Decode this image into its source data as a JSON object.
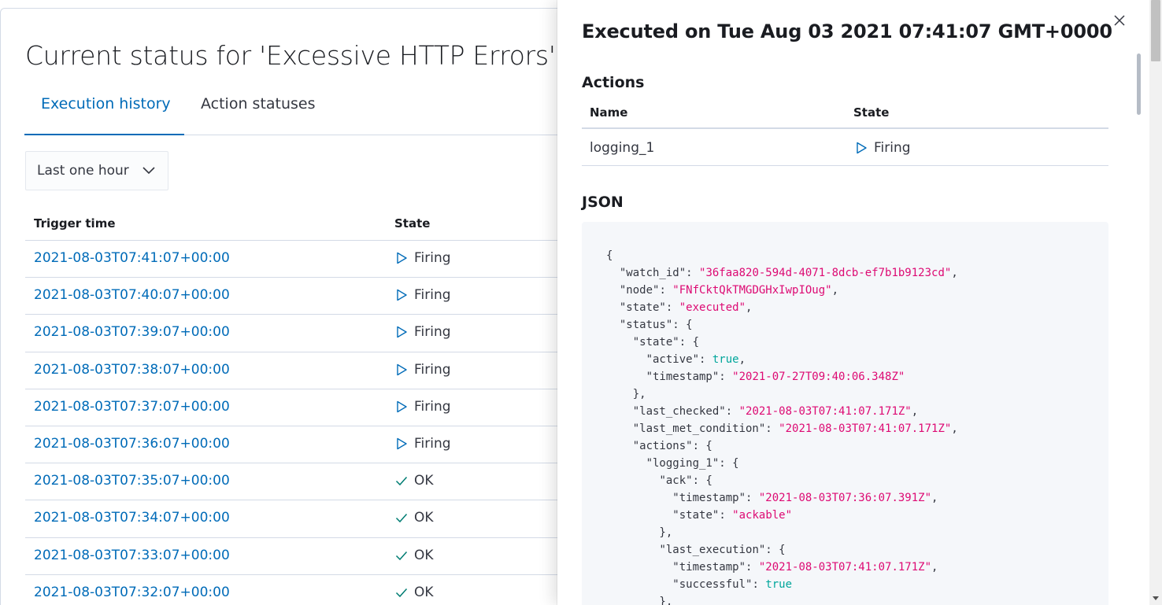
{
  "page": {
    "title": "Current status for 'Excessive HTTP Errors'",
    "tabs": [
      {
        "label": "Execution history",
        "active": true
      },
      {
        "label": "Action statuses",
        "active": false
      }
    ],
    "range_select": {
      "value": "Last one hour",
      "icon": "chevron-down-icon"
    },
    "history_table": {
      "columns": [
        "Trigger time",
        "State"
      ],
      "rows": [
        {
          "time": "2021-08-03T07:41:07+00:00",
          "state": "Firing",
          "icon": "play-icon"
        },
        {
          "time": "2021-08-03T07:40:07+00:00",
          "state": "Firing",
          "icon": "play-icon"
        },
        {
          "time": "2021-08-03T07:39:07+00:00",
          "state": "Firing",
          "icon": "play-icon"
        },
        {
          "time": "2021-08-03T07:38:07+00:00",
          "state": "Firing",
          "icon": "play-icon"
        },
        {
          "time": "2021-08-03T07:37:07+00:00",
          "state": "Firing",
          "icon": "play-icon"
        },
        {
          "time": "2021-08-03T07:36:07+00:00",
          "state": "Firing",
          "icon": "play-icon"
        },
        {
          "time": "2021-08-03T07:35:07+00:00",
          "state": "OK",
          "icon": "check-icon"
        },
        {
          "time": "2021-08-03T07:34:07+00:00",
          "state": "OK",
          "icon": "check-icon"
        },
        {
          "time": "2021-08-03T07:33:07+00:00",
          "state": "OK",
          "icon": "check-icon"
        },
        {
          "time": "2021-08-03T07:32:07+00:00",
          "state": "OK",
          "icon": "check-icon"
        }
      ]
    }
  },
  "flyout": {
    "title": "Executed on Tue Aug 03 2021 07:41:07 GMT+0000",
    "close_icon": "close-icon",
    "actions_title": "Actions",
    "actions_table": {
      "columns": [
        "Name",
        "State"
      ],
      "rows": [
        {
          "name": "logging_1",
          "state": "Firing",
          "icon": "play-icon"
        }
      ]
    },
    "json_title": "JSON",
    "json_lines": [
      [
        [
          "p",
          "{"
        ]
      ],
      [
        [
          "p",
          "  "
        ],
        [
          "k",
          "\"watch_id\""
        ],
        [
          "p",
          ": "
        ],
        [
          "s",
          "\"36faa820-594d-4071-8dcb-ef7b1b9123cd\""
        ],
        [
          "p",
          ","
        ]
      ],
      [
        [
          "p",
          "  "
        ],
        [
          "k",
          "\"node\""
        ],
        [
          "p",
          ": "
        ],
        [
          "s",
          "\"FNfCktQkTMGDGHxIwpIOug\""
        ],
        [
          "p",
          ","
        ]
      ],
      [
        [
          "p",
          "  "
        ],
        [
          "k",
          "\"state\""
        ],
        [
          "p",
          ": "
        ],
        [
          "s",
          "\"executed\""
        ],
        [
          "p",
          ","
        ]
      ],
      [
        [
          "p",
          "  "
        ],
        [
          "k",
          "\"status\""
        ],
        [
          "p",
          ": {"
        ]
      ],
      [
        [
          "p",
          "    "
        ],
        [
          "k",
          "\"state\""
        ],
        [
          "p",
          ": {"
        ]
      ],
      [
        [
          "p",
          "      "
        ],
        [
          "k",
          "\"active\""
        ],
        [
          "p",
          ": "
        ],
        [
          "b",
          "true"
        ],
        [
          "p",
          ","
        ]
      ],
      [
        [
          "p",
          "      "
        ],
        [
          "k",
          "\"timestamp\""
        ],
        [
          "p",
          ": "
        ],
        [
          "s",
          "\"2021-07-27T09:40:06.348Z\""
        ]
      ],
      [
        [
          "p",
          "    },"
        ]
      ],
      [
        [
          "p",
          "    "
        ],
        [
          "k",
          "\"last_checked\""
        ],
        [
          "p",
          ": "
        ],
        [
          "s",
          "\"2021-08-03T07:41:07.171Z\""
        ],
        [
          "p",
          ","
        ]
      ],
      [
        [
          "p",
          "    "
        ],
        [
          "k",
          "\"last_met_condition\""
        ],
        [
          "p",
          ": "
        ],
        [
          "s",
          "\"2021-08-03T07:41:07.171Z\""
        ],
        [
          "p",
          ","
        ]
      ],
      [
        [
          "p",
          "    "
        ],
        [
          "k",
          "\"actions\""
        ],
        [
          "p",
          ": {"
        ]
      ],
      [
        [
          "p",
          "      "
        ],
        [
          "k",
          "\"logging_1\""
        ],
        [
          "p",
          ": {"
        ]
      ],
      [
        [
          "p",
          "        "
        ],
        [
          "k",
          "\"ack\""
        ],
        [
          "p",
          ": {"
        ]
      ],
      [
        [
          "p",
          "          "
        ],
        [
          "k",
          "\"timestamp\""
        ],
        [
          "p",
          ": "
        ],
        [
          "s",
          "\"2021-08-03T07:36:07.391Z\""
        ],
        [
          "p",
          ","
        ]
      ],
      [
        [
          "p",
          "          "
        ],
        [
          "k",
          "\"state\""
        ],
        [
          "p",
          ": "
        ],
        [
          "s",
          "\"ackable\""
        ]
      ],
      [
        [
          "p",
          "        },"
        ]
      ],
      [
        [
          "p",
          "        "
        ],
        [
          "k",
          "\"last_execution\""
        ],
        [
          "p",
          ": {"
        ]
      ],
      [
        [
          "p",
          "          "
        ],
        [
          "k",
          "\"timestamp\""
        ],
        [
          "p",
          ": "
        ],
        [
          "s",
          "\"2021-08-03T07:41:07.171Z\""
        ],
        [
          "p",
          ","
        ]
      ],
      [
        [
          "p",
          "          "
        ],
        [
          "k",
          "\"successful\""
        ],
        [
          "p",
          ": "
        ],
        [
          "b",
          "true"
        ]
      ],
      [
        [
          "p",
          "        },"
        ]
      ]
    ],
    "colors": {
      "link": "#006bb8",
      "string": "#dd0a73",
      "boolean": "#00a69b"
    }
  }
}
